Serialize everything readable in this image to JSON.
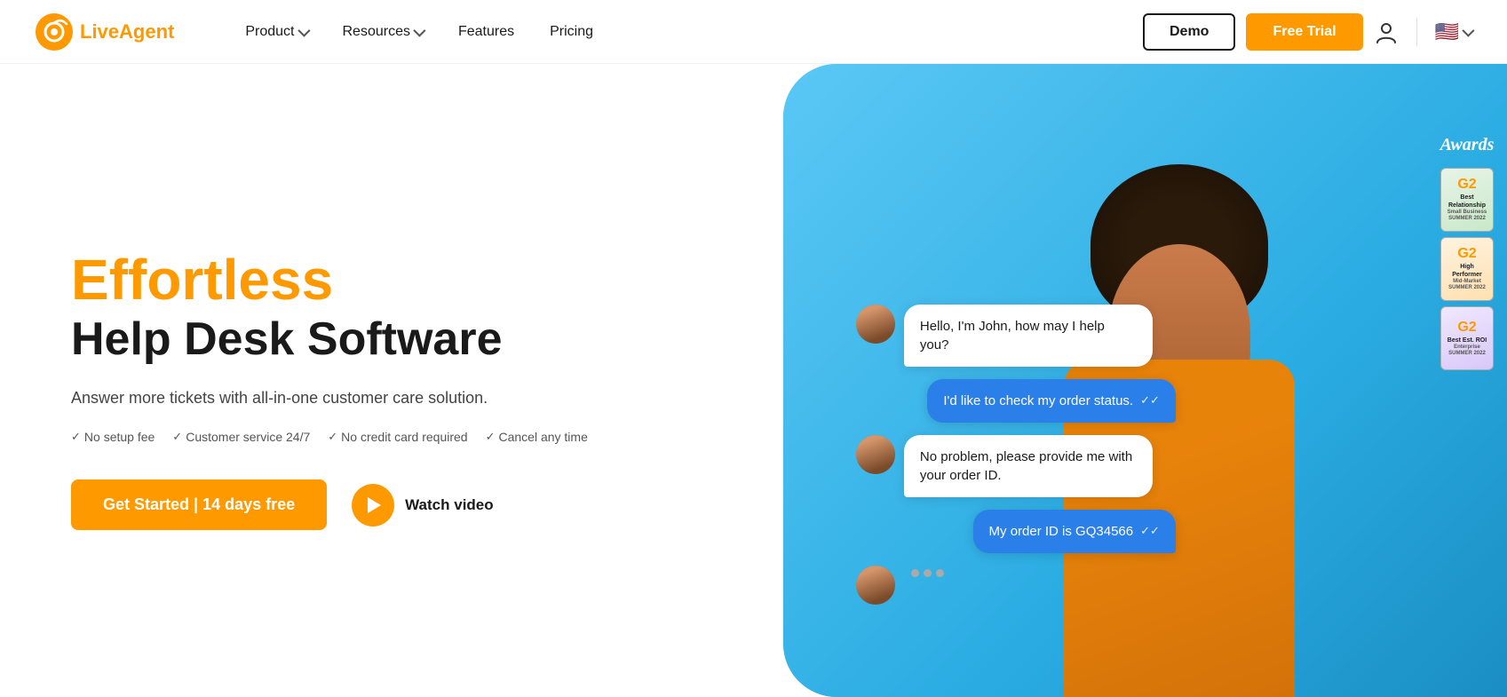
{
  "logo": {
    "live": "Live",
    "agent": "Agent",
    "aria": "LiveAgent Home"
  },
  "nav": {
    "product_label": "Product",
    "resources_label": "Resources",
    "features_label": "Features",
    "pricing_label": "Pricing",
    "demo_label": "Demo",
    "free_trial_label": "Free Trial"
  },
  "hero": {
    "effortless": "Effortless",
    "headline": "Help Desk Software",
    "sub": "Answer more tickets with all-in-one customer care solution.",
    "check1": "No setup fee",
    "check2": "Customer service 24/7",
    "check3": "No credit card required",
    "check4": "Cancel any time",
    "cta_label": "Get Started | 14 days free",
    "watch_video": "Watch video"
  },
  "chat": {
    "bubble1": "Hello, I'm John, how may I help you?",
    "bubble2": "I'd like to check my order status.",
    "bubble3": "No problem, please provide me with your order ID.",
    "bubble4": "My order ID is GQ34566"
  },
  "awards": {
    "title": "Awards",
    "badge1_main": "Best Relationship",
    "badge1_sub": "Small Business\nSUMMER\n2022",
    "badge2_main": "High Performer",
    "badge2_sub": "Mid-Market\nSUMMER\n2022",
    "badge3_main": "Best Est. ROI",
    "badge3_sub": "Enterprise\nSUMMER\n2022"
  },
  "colors": {
    "orange": "#f90",
    "blue_cta": "#2A7FE8",
    "hero_bg": "#3bbdec"
  }
}
